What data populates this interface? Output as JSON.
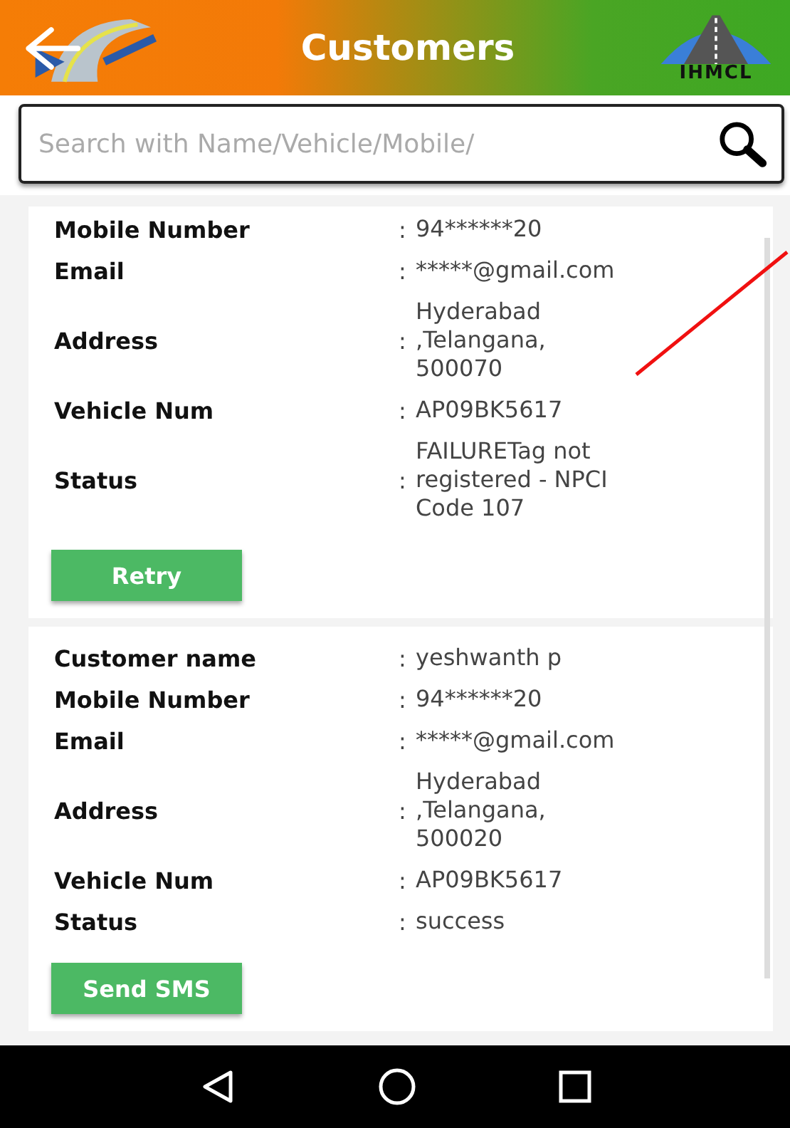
{
  "header": {
    "title": "Customers",
    "logo_text": "IHMCL"
  },
  "search": {
    "placeholder": "Search with Name/Vehicle/Mobile/"
  },
  "customers": [
    {
      "fields": [
        {
          "label": "Mobile Number",
          "separator": ":",
          "value": "94******20"
        },
        {
          "label": "Email",
          "separator": ":",
          "value": "*****@gmail.com"
        },
        {
          "label": "Address",
          "separator": ":",
          "value": "Hyderabad ,Telangana, 500070"
        },
        {
          "label": "Vehicle Num",
          "separator": ":",
          "value": "AP09BK5617"
        },
        {
          "label": "Status",
          "separator": ":",
          "value": "FAILURETag not registered - NPCI Code 107"
        }
      ],
      "button": "Retry"
    },
    {
      "fields": [
        {
          "label": "Customer name",
          "separator": ":",
          "value": "yeshwanth p"
        },
        {
          "label": "Mobile Number",
          "separator": ":",
          "value": "94******20"
        },
        {
          "label": "Email",
          "separator": ":",
          "value": "*****@gmail.com"
        },
        {
          "label": "Address",
          "separator": ":",
          "value": "Hyderabad ,Telangana, 500020"
        },
        {
          "label": "Vehicle Num",
          "separator": ":",
          "value": "AP09BK5617"
        },
        {
          "label": "Status",
          "separator": ":",
          "value": "success"
        }
      ],
      "button": "Send SMS"
    }
  ]
}
